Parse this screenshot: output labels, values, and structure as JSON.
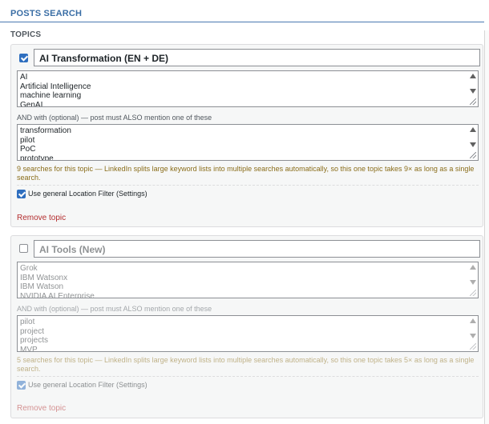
{
  "header": {
    "title": "POSTS SEARCH"
  },
  "topics_label": "TOPICS",
  "topics": [
    {
      "enabled": true,
      "name": "AI Transformation (EN + DE)",
      "keywords": [
        "AI",
        "Artificial Intelligence",
        "machine learning",
        "GenAI"
      ],
      "and_label": "AND with (optional) — post must ALSO mention one of these",
      "and_keywords": [
        "transformation",
        "pilot",
        "PoC",
        "prototype"
      ],
      "note": "9 searches for this topic — LinkedIn splits large keyword lists into multiple searches automatically, so this one topic takes 9× as long as a single search.",
      "location_label": "Use general Location Filter (Settings)",
      "location_checked": true,
      "remove_label": "Remove topic"
    },
    {
      "enabled": false,
      "name": "AI Tools (New)",
      "keywords": [
        "Grok",
        "IBM Watsonx",
        "IBM Watson",
        "NVIDIA AI Enterprise"
      ],
      "and_label": "AND with (optional) — post must ALSO mention one of these",
      "and_keywords": [
        "pilot",
        "project",
        "projects",
        "MVP"
      ],
      "note": "5 searches for this topic — LinkedIn splits large keyword lists into multiple searches automatically, so this one topic takes 5× as long as a single search.",
      "location_label": "Use general Location Filter (Settings)",
      "location_checked": true,
      "remove_label": "Remove topic"
    }
  ],
  "colors": {
    "accent": "#2f6fbf",
    "header_text": "#3a6ea5",
    "note": "#8a6d1a",
    "remove": "#b32d2e"
  }
}
